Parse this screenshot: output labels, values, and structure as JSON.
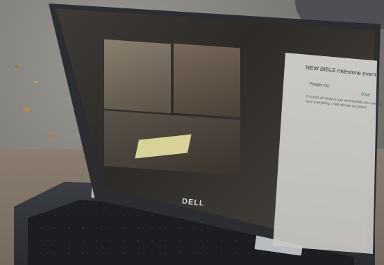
{
  "screen": {
    "panel_title": "NEW BIBLE milestone event",
    "people_label": "People (5)",
    "chat_tab": "Chat",
    "message_preview": "It is kind of windy to say we hopefully you can still hear everything, it will also be recorded."
  },
  "device": {
    "brand": "DELL"
  }
}
